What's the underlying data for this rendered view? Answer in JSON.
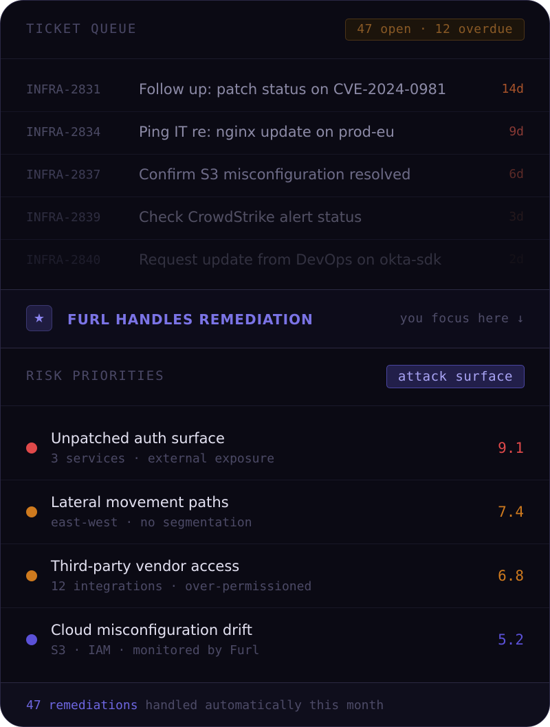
{
  "queue": {
    "title": "TICKET QUEUE",
    "badge": "47 open · 12 overdue",
    "tickets": [
      {
        "id": "INFRA-2831",
        "title": "Follow up: patch status on CVE-2024-0981",
        "age": "14d",
        "age_color": "#a8532a"
      },
      {
        "id": "INFRA-2834",
        "title": "Ping IT re: nginx update on prod-eu",
        "age": "9d",
        "age_color": "#8a3a35"
      },
      {
        "id": "INFRA-2837",
        "title": "Confirm S3 misconfiguration resolved",
        "age": "6d",
        "age_color": "#5b2a27"
      },
      {
        "id": "INFRA-2839",
        "title": "Check CrowdStrike alert status",
        "age": "3d",
        "age_color": "#3a2424"
      },
      {
        "id": "INFRA-2840",
        "title": "Request update from DevOps on okta-sdk",
        "age": "2d",
        "age_color": "#2c2222"
      }
    ]
  },
  "banner": {
    "icon": "star-icon",
    "icon_glyph": "★",
    "title": "FURL HANDLES REMEDIATION",
    "hint": "you focus here ↓"
  },
  "risk": {
    "title": "RISK PRIORITIES",
    "tag": "attack surface",
    "items": [
      {
        "name": "Unpatched auth surface",
        "meta": "3 services · external exposure",
        "score": "9.1",
        "color": "#e0494a"
      },
      {
        "name": "Lateral movement paths",
        "meta": "east-west · no segmentation",
        "score": "7.4",
        "color": "#cf7a1e"
      },
      {
        "name": "Third-party vendor access",
        "meta": "12 integrations · over-permissioned",
        "score": "6.8",
        "color": "#cf7a1e"
      },
      {
        "name": "Cloud misconfiguration drift",
        "meta": "S3 · IAM · monitored by Furl",
        "score": "5.2",
        "color": "#5b51d8"
      }
    ]
  },
  "footer": {
    "count": "47 remediations",
    "text": " handled automatically this month"
  }
}
